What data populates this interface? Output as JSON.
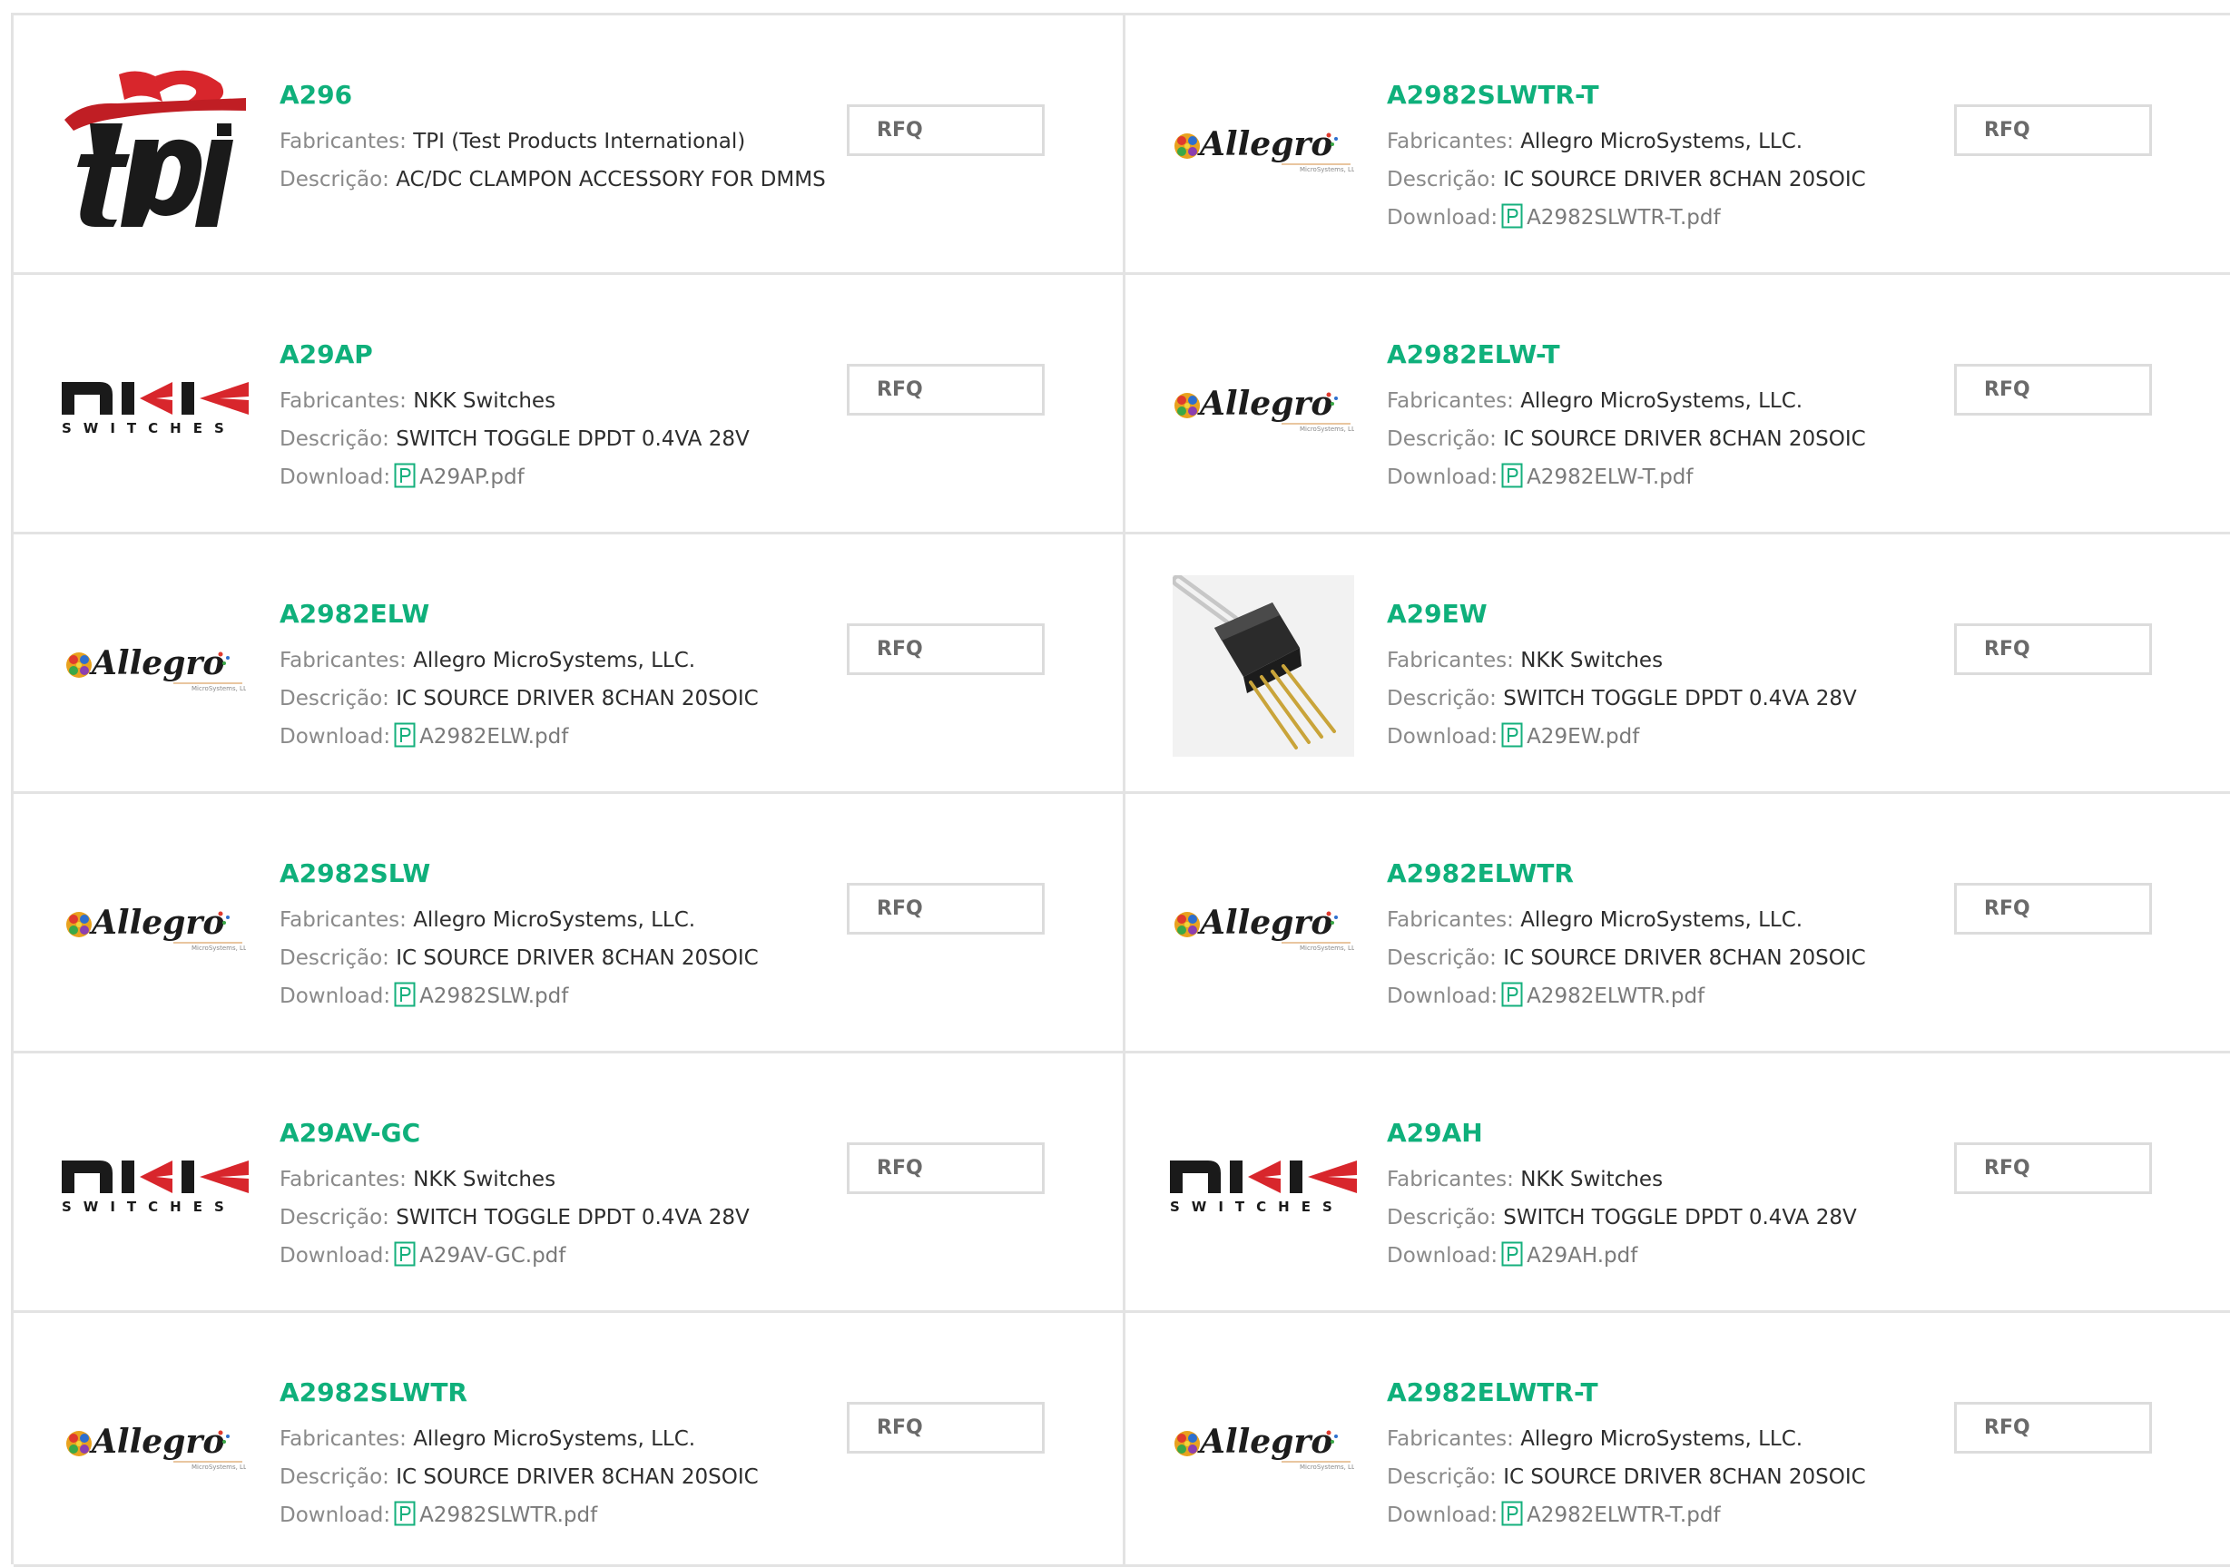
{
  "labels": {
    "manufacturer": "Fabricantes:",
    "description": "Descrição:",
    "download": "Download:",
    "rfq": "RFQ"
  },
  "colors": {
    "title": "#0fb07b",
    "border": "#e3e3e3"
  },
  "products": [
    {
      "part": "A296",
      "logo": "tpi-logo",
      "manufacturer": "TPI (Test Products International)",
      "description": "AC/DC CLAMPON ACCESSORY FOR DMMS",
      "pdf": ""
    },
    {
      "part": "A2982SLWTR-T",
      "logo": "allegro-logo",
      "manufacturer": "Allegro MicroSystems, LLC.",
      "description": "IC SOURCE DRIVER 8CHAN 20SOIC",
      "pdf": "A2982SLWTR-T.pdf"
    },
    {
      "part": "A29AP",
      "logo": "nkk-switches-logo",
      "manufacturer": "NKK Switches",
      "description": "SWITCH TOGGLE DPDT 0.4VA 28V",
      "pdf": "A29AP.pdf"
    },
    {
      "part": "A2982ELW-T",
      "logo": "allegro-logo",
      "manufacturer": "Allegro MicroSystems, LLC.",
      "description": "IC SOURCE DRIVER 8CHAN 20SOIC",
      "pdf": "A2982ELW-T.pdf"
    },
    {
      "part": "A2982ELW",
      "logo": "allegro-logo",
      "manufacturer": "Allegro MicroSystems, LLC.",
      "description": "IC SOURCE DRIVER 8CHAN 20SOIC",
      "pdf": "A2982ELW.pdf"
    },
    {
      "part": "A29EW",
      "logo": "toggle-switch-photo",
      "manufacturer": "NKK Switches",
      "description": "SWITCH TOGGLE DPDT 0.4VA 28V",
      "pdf": "A29EW.pdf"
    },
    {
      "part": "A2982SLW",
      "logo": "allegro-logo",
      "manufacturer": "Allegro MicroSystems, LLC.",
      "description": "IC SOURCE DRIVER 8CHAN 20SOIC",
      "pdf": "A2982SLW.pdf"
    },
    {
      "part": "A2982ELWTR",
      "logo": "allegro-logo",
      "manufacturer": "Allegro MicroSystems, LLC.",
      "description": "IC SOURCE DRIVER 8CHAN 20SOIC",
      "pdf": "A2982ELWTR.pdf"
    },
    {
      "part": "A29AV-GC",
      "logo": "nkk-switches-logo",
      "manufacturer": "NKK Switches",
      "description": "SWITCH TOGGLE DPDT 0.4VA 28V",
      "pdf": "A29AV-GC.pdf"
    },
    {
      "part": "A29AH",
      "logo": "nkk-switches-logo",
      "manufacturer": "NKK Switches",
      "description": "SWITCH TOGGLE DPDT 0.4VA 28V",
      "pdf": "A29AH.pdf"
    },
    {
      "part": "A2982SLWTR",
      "logo": "allegro-logo",
      "manufacturer": "Allegro MicroSystems, LLC.",
      "description": "IC SOURCE DRIVER 8CHAN 20SOIC",
      "pdf": "A2982SLWTR.pdf"
    },
    {
      "part": "A2982ELWTR-T",
      "logo": "allegro-logo",
      "manufacturer": "Allegro MicroSystems, LLC.",
      "description": "IC SOURCE DRIVER 8CHAN 20SOIC",
      "pdf": "A2982ELWTR-T.pdf"
    }
  ]
}
